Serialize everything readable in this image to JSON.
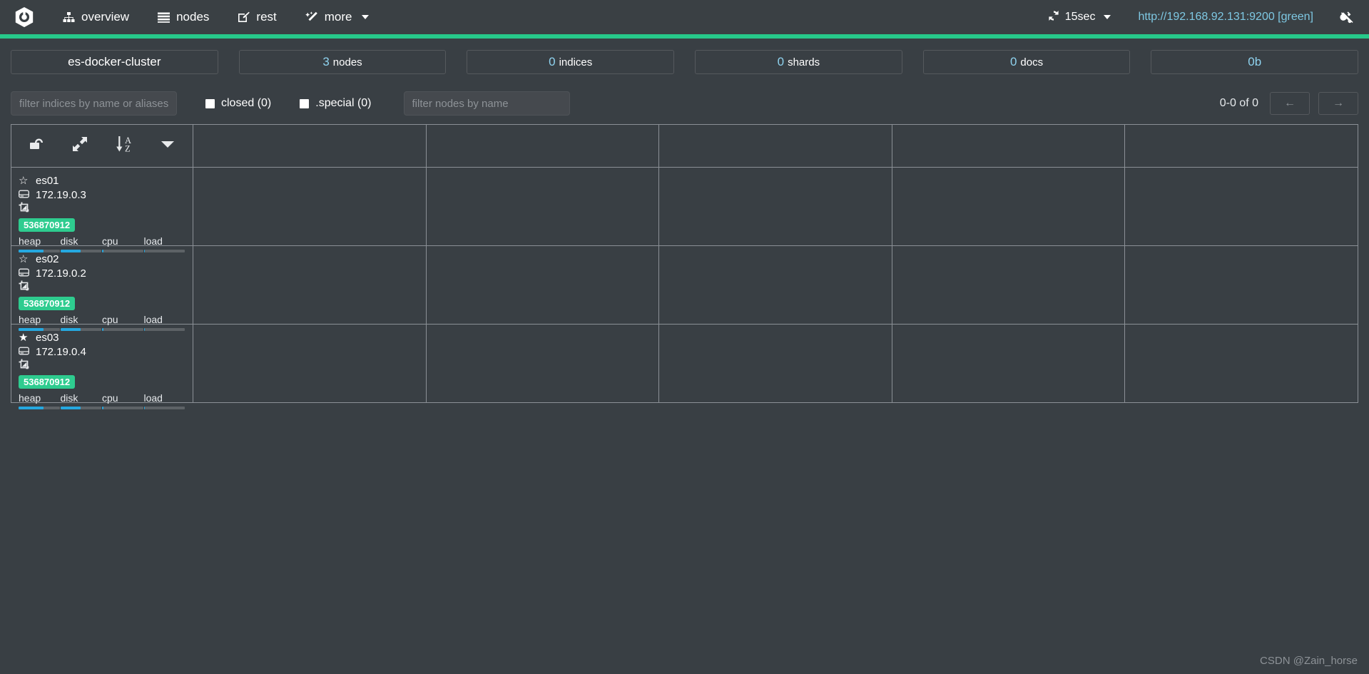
{
  "navbar": {
    "brand_icon": "cerebro-logo-icon",
    "items": [
      {
        "label": "overview",
        "icon": "sitemap-icon"
      },
      {
        "label": "nodes",
        "icon": "list-icon"
      },
      {
        "label": "rest",
        "icon": "edit-square-icon"
      },
      {
        "label": "more",
        "icon": "magic-wand-icon",
        "has_caret": true
      }
    ],
    "refresh": {
      "label": "15sec",
      "icon": "refresh-icon",
      "has_caret": true
    },
    "cluster_url": "http://192.168.92.131:9200 [green]",
    "disconnect_icon": "plug-icon",
    "accent_color": "#27c98a",
    "url_color": "#7ec8e3"
  },
  "stats": [
    {
      "value": "es-docker-cluster",
      "label": "",
      "value_only": true
    },
    {
      "value": "3",
      "label": "nodes"
    },
    {
      "value": "0",
      "label": "indices"
    },
    {
      "value": "0",
      "label": "shards"
    },
    {
      "value": "0",
      "label": "docs"
    },
    {
      "value": "0b",
      "label": "",
      "cyan_only": true
    }
  ],
  "filters": {
    "indices_placeholder": "filter indices by name or aliases",
    "indices_value": "",
    "closed_label": "closed (0)",
    "closed_checked": false,
    "special_label": ".special (0)",
    "special_checked": false,
    "nodes_placeholder": "filter nodes by name",
    "nodes_value": "",
    "pager_label": "0-0 of 0",
    "prev_label": "←",
    "next_label": "→"
  },
  "table": {
    "header_buttons": [
      {
        "name": "lock-toggle",
        "icon": "unlock-icon"
      },
      {
        "name": "expand-toggle",
        "icon": "expand-arrows-icon"
      },
      {
        "name": "sort-toggle",
        "icon": "sort-alpha-asc-icon"
      },
      {
        "name": "filter-dropdown",
        "icon": "caret-down-icon"
      }
    ],
    "column_count": 6,
    "nodes": [
      {
        "name": "es01",
        "master": false,
        "ip": "172.19.0.3",
        "role_icon": "data-node-icon",
        "badge": "536870912",
        "meters": [
          {
            "label": "heap",
            "percent": 60
          },
          {
            "label": "disk",
            "percent": 50
          },
          {
            "label": "cpu",
            "percent": 3
          },
          {
            "label": "load",
            "percent": 3
          }
        ]
      },
      {
        "name": "es02",
        "master": false,
        "ip": "172.19.0.2",
        "role_icon": "data-node-icon",
        "badge": "536870912",
        "meters": [
          {
            "label": "heap",
            "percent": 60
          },
          {
            "label": "disk",
            "percent": 50
          },
          {
            "label": "cpu",
            "percent": 3
          },
          {
            "label": "load",
            "percent": 3
          }
        ]
      },
      {
        "name": "es03",
        "master": true,
        "ip": "172.19.0.4",
        "role_icon": "data-node-icon",
        "badge": "536870912",
        "meters": [
          {
            "label": "heap",
            "percent": 60
          },
          {
            "label": "disk",
            "percent": 50
          },
          {
            "label": "cpu",
            "percent": 3
          },
          {
            "label": "load",
            "percent": 3
          }
        ]
      }
    ]
  },
  "watermark": "CSDN @Zain_horse"
}
